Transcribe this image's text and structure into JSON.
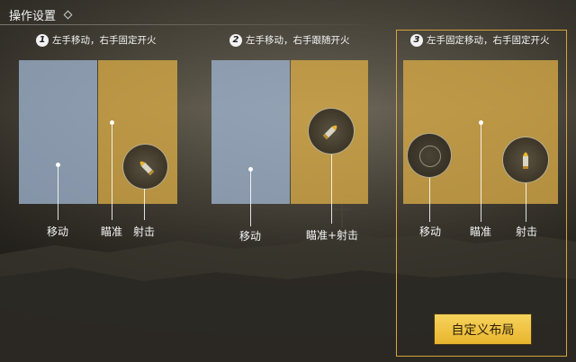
{
  "page": {
    "title": "操作设置"
  },
  "options": [
    {
      "number": "1",
      "label": "左手移动，右手固定开火",
      "zone_labels": {
        "move": "移动",
        "aim": "瞄准",
        "shoot": "射击"
      }
    },
    {
      "number": "2",
      "label": "左手移动，右手跟随开火",
      "zone_labels": {
        "move": "移动",
        "aim_shoot": "瞄准+射击"
      }
    },
    {
      "number": "3",
      "label": "左手固定移动，右手固定开火",
      "zone_labels": {
        "move": "移动",
        "aim": "瞄准",
        "shoot": "射击"
      }
    }
  ],
  "selected_option": 3,
  "custom_layout_button": {
    "label": "自定义布局"
  },
  "colors": {
    "accent_gold": "#d7a23a",
    "button_gold": "#f0c240",
    "zone_blue": "#9eb2cd",
    "zone_gold": "#d7aa46"
  },
  "icons": {
    "fire_button": "bullet-icon",
    "move_joystick": "joystick-icon"
  }
}
